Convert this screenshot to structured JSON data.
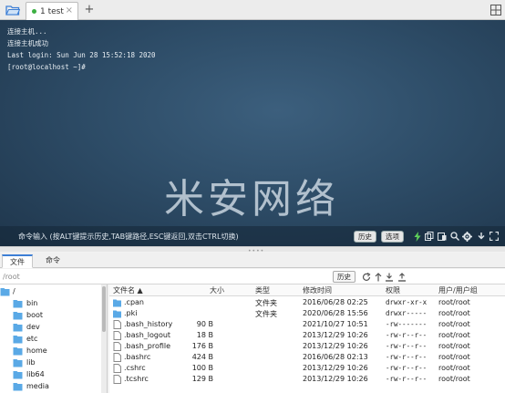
{
  "tab": {
    "label": "1 test",
    "close": "×",
    "add": "+"
  },
  "terminal": {
    "lines": [
      "连接主机...",
      "连接主机成功",
      "Last login: Sun Jun 28 15:52:18 2020",
      "[root@localhost ~]#"
    ],
    "watermark": "米安网络",
    "command_placeholder": "命令输入 (按ALT键提示历史,TAB键路径,ESC键返回,双击CTRL切换)",
    "history_button": "历史",
    "options_button": "选项"
  },
  "panel_tabs": [
    "文件",
    "命令"
  ],
  "path": {
    "value": "/root",
    "history_button": "历史"
  },
  "tree": {
    "root": "/",
    "items": [
      "bin",
      "boot",
      "dev",
      "etc",
      "home",
      "lib",
      "lib64",
      "media"
    ]
  },
  "files": {
    "headers": [
      "文件名 ▲",
      "大小",
      "类型",
      "修改时间",
      "权限",
      "用户/用户组"
    ],
    "rows": [
      {
        "name": ".cpan",
        "size": "",
        "type": "文件夹",
        "mtime": "2016/06/28 02:25",
        "perm": "drwxr-xr-x",
        "owner": "root/root",
        "kind": "folder"
      },
      {
        "name": ".pki",
        "size": "",
        "type": "文件夹",
        "mtime": "2020/06/28 15:56",
        "perm": "drwxr-----",
        "owner": "root/root",
        "kind": "folder"
      },
      {
        "name": ".bash_history",
        "size": "90 B",
        "type": "",
        "mtime": "2021/10/27 10:51",
        "perm": "-rw-------",
        "owner": "root/root",
        "kind": "file"
      },
      {
        "name": ".bash_logout",
        "size": "18 B",
        "type": "",
        "mtime": "2013/12/29 10:26",
        "perm": "-rw-r--r--",
        "owner": "root/root",
        "kind": "file"
      },
      {
        "name": ".bash_profile",
        "size": "176 B",
        "type": "",
        "mtime": "2013/12/29 10:26",
        "perm": "-rw-r--r--",
        "owner": "root/root",
        "kind": "file"
      },
      {
        "name": ".bashrc",
        "size": "424 B",
        "type": "",
        "mtime": "2016/06/28 02:13",
        "perm": "-rw-r--r--",
        "owner": "root/root",
        "kind": "file"
      },
      {
        "name": ".cshrc",
        "size": "100 B",
        "type": "",
        "mtime": "2013/12/29 10:26",
        "perm": "-rw-r--r--",
        "owner": "root/root",
        "kind": "file"
      },
      {
        "name": ".tcshrc",
        "size": "129 B",
        "type": "",
        "mtime": "2013/12/29 10:26",
        "perm": "-rw-r--r--",
        "owner": "root/root",
        "kind": "file"
      }
    ]
  },
  "colors": {
    "folder": "#5aa9e6",
    "accent": "#3d7fd6",
    "tab_dot": "#3cb043",
    "terminal_bg": "#2e4d68"
  },
  "icons": [
    "folder-open-icon",
    "grid-icon",
    "lightning-icon",
    "copy-icon",
    "paste-icon",
    "search-icon",
    "gear-icon",
    "download-icon",
    "fullscreen-icon",
    "refresh-icon",
    "up-icon",
    "download-icon",
    "upload-icon"
  ]
}
